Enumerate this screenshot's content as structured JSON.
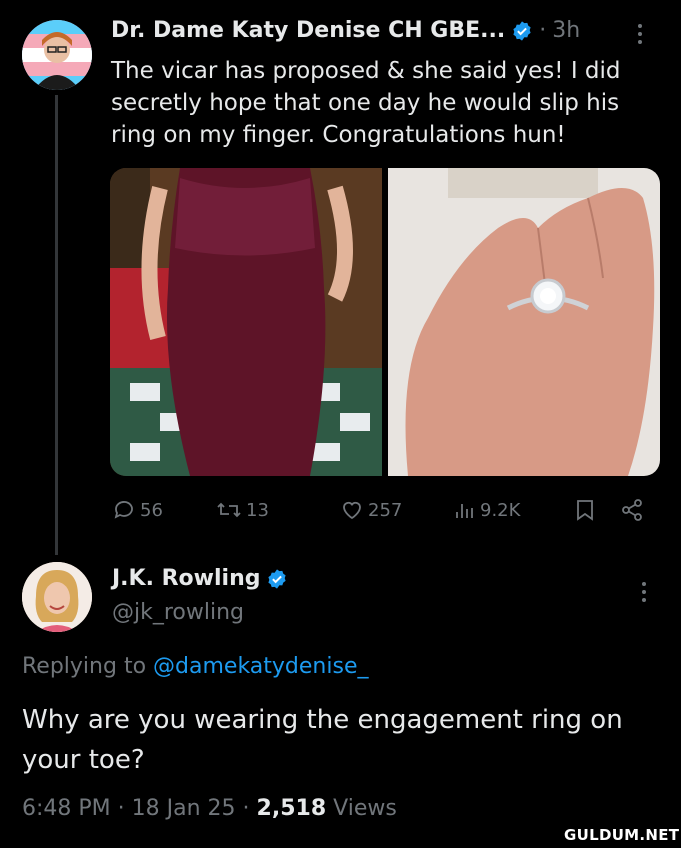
{
  "tweet1": {
    "display_name": "Dr. Dame Katy Denise CH GBE...",
    "separator": "·",
    "time": "3h",
    "text": "The vicar has proposed & she said yes! I did secretly hope that one day he would slip his ring on my finger. Congratulations hun!",
    "media": [
      {
        "icon": "dress-photo",
        "alt": ""
      },
      {
        "icon": "ring-photo",
        "alt": ""
      }
    ],
    "actions": {
      "replies": "56",
      "reposts": "13",
      "likes": "257",
      "views": "9.2K"
    }
  },
  "tweet2": {
    "display_name": "J.K. Rowling",
    "handle": "@jk_rowling",
    "replying_prefix": "Replying to",
    "replying_to": "@damekatydenise_",
    "text": "Why are you wearing the engagement ring on your toe?",
    "time": "6:48 PM",
    "date": "18 Jan 25",
    "views_count": "2,518",
    "views_label": "Views"
  },
  "watermark": "GULDUM.NET",
  "colors": {
    "background": "#000000",
    "text": "#e7e9ea",
    "secondary": "#71767b",
    "accent": "#1d9bf0"
  }
}
